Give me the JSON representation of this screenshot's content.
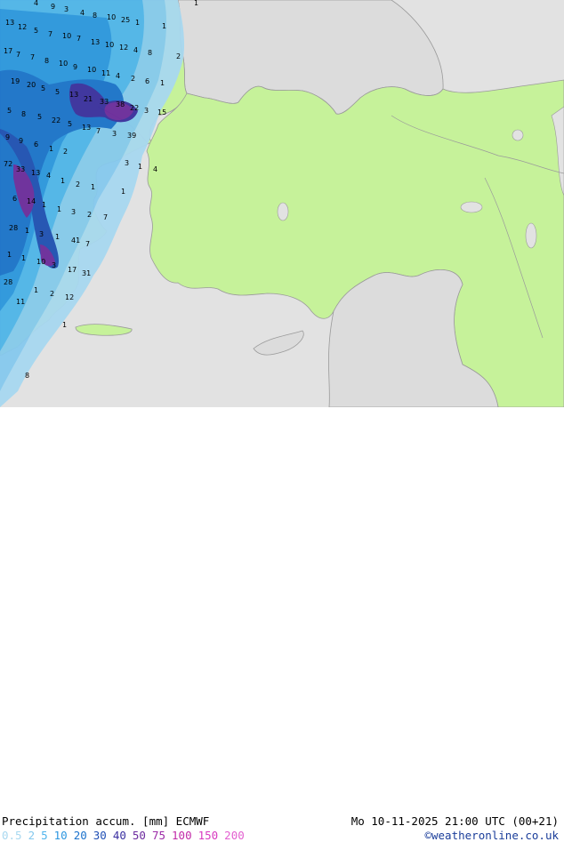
{
  "title": "Precipitation accum. [mm] ECMWF",
  "datetime": "Mo 10-11-2025 21:00 UTC (00+21)",
  "credit": "©weatheronline.co.uk",
  "legend": [
    {
      "label": "0.5",
      "color": "#a8d8f0"
    },
    {
      "label": "2",
      "color": "#86c9ee"
    },
    {
      "label": "5",
      "color": "#4fb4ec"
    },
    {
      "label": "10",
      "color": "#2c96e0"
    },
    {
      "label": "20",
      "color": "#1b72cc"
    },
    {
      "label": "30",
      "color": "#1f4fb5"
    },
    {
      "label": "40",
      "color": "#3a2fa0"
    },
    {
      "label": "50",
      "color": "#6c2a9e"
    },
    {
      "label": "75",
      "color": "#9c2aa8"
    },
    {
      "label": "100",
      "color": "#c22aa8"
    },
    {
      "label": "150",
      "color": "#d83ac0"
    },
    {
      "label": "200",
      "color": "#e35fd0"
    }
  ],
  "colors": {
    "sea": "#e2e2e2",
    "land": "#c6f29a",
    "other_land": "#dcdcdc",
    "border": "#9a9a9a"
  },
  "values": [
    "4",
    "9",
    "3",
    "4",
    "8",
    "10",
    "25",
    "1",
    "13",
    "12",
    "5",
    "7",
    "10",
    "7",
    "13",
    "10",
    "12",
    "4",
    "8",
    "1",
    "2",
    "1",
    "17",
    "7",
    "7",
    "8",
    "10",
    "9",
    "10",
    "11",
    "4",
    "2",
    "6",
    "1",
    "19",
    "20",
    "5",
    "5",
    "13",
    "21",
    "33",
    "38",
    "22",
    "3",
    "15",
    "5",
    "8",
    "5",
    "22",
    "5",
    "13",
    "7",
    "3",
    "39",
    "9",
    "9",
    "6",
    "1",
    "2",
    "3",
    "1",
    "4",
    "72",
    "33",
    "13",
    "4",
    "1",
    "2",
    "1",
    "1",
    "6",
    "14",
    "1",
    "1",
    "3",
    "2",
    "7",
    "28",
    "1",
    "3",
    "1",
    "41",
    "7",
    "1",
    "1",
    "10",
    "3",
    "17",
    "31",
    "28",
    "1",
    "2",
    "12",
    "11",
    "1",
    "8",
    "4"
  ]
}
